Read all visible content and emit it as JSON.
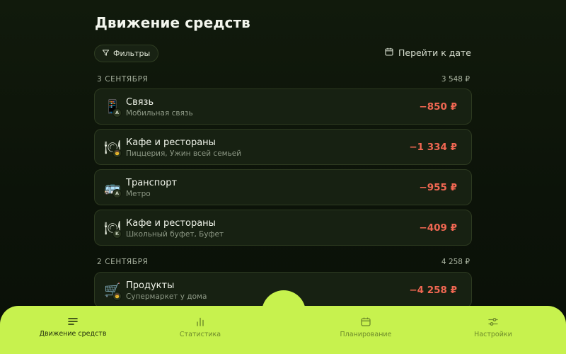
{
  "page": {
    "title": "Движение средств"
  },
  "toolbar": {
    "filter_label": "Фильтры",
    "goto_date_label": "Перейти к дате"
  },
  "sections": [
    {
      "date": "3 СЕНТЯБРЯ",
      "total": "3 548 ₽",
      "items": [
        {
          "emoji": "📱",
          "badge": "A",
          "title": "Связь",
          "subtitle": "Мобильная связь",
          "amount": "−850 ₽"
        },
        {
          "emoji": "🍽",
          "badge": "👨",
          "title": "Кафе и рестораны",
          "subtitle": "Пиццерия, Ужин всей семьей",
          "amount": "−1 334 ₽"
        },
        {
          "emoji": "🚌",
          "badge": "A",
          "title": "Транспорт",
          "subtitle": "Метро",
          "amount": "−955 ₽"
        },
        {
          "emoji": "🍽",
          "badge": "K",
          "title": "Кафе и рестораны",
          "subtitle": "Школьный буфет, Буфет",
          "amount": "−409 ₽"
        }
      ]
    },
    {
      "date": "2 СЕНТЯБРЯ",
      "total": "4 258 ₽",
      "items": [
        {
          "emoji": "🛒",
          "badge": "👨",
          "title": "Продукты",
          "subtitle": "Супермаркет у дома",
          "amount": "−4 258 ₽"
        }
      ]
    }
  ],
  "nav": {
    "items": [
      {
        "label": "Движение средств",
        "icon": "list-icon",
        "active": true
      },
      {
        "label": "Статистика",
        "icon": "bar-chart-icon",
        "active": false
      },
      {
        "label": "Планирование",
        "icon": "calendar-icon",
        "active": false
      },
      {
        "label": "Настройки",
        "icon": "sliders-icon",
        "active": false
      }
    ]
  },
  "colors": {
    "accent": "#c7f24e",
    "negative": "#f06752",
    "background": "#0c1309",
    "card": "#172112"
  }
}
